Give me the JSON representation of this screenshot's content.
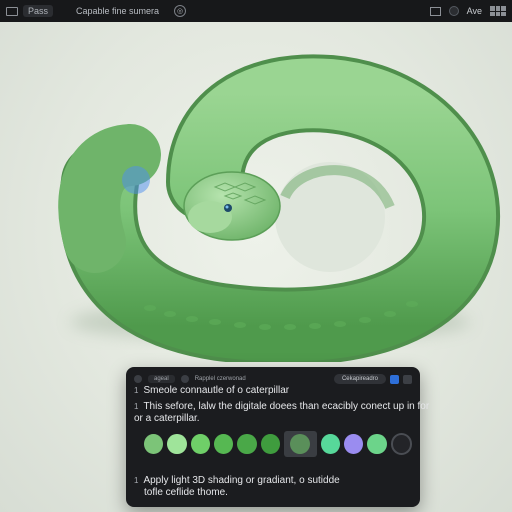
{
  "topbar": {
    "left_chip": "Pass",
    "title": "Capable fine sumera",
    "right_chip": "Ave"
  },
  "panel": {
    "toolbar_left": "ageal",
    "toolbar_middle": "Rapplel czerwonad",
    "toolbar_pill": "Cekapireadro",
    "line1_num": "1",
    "line1": "Smeole connautle of o caterpillar",
    "line2_num": "1",
    "line2a": "This sefore, lalw the digitale doees than ecacibly conect up in for",
    "line2b": "or a caterpillar.",
    "line3_num": "1",
    "line3a": "Apply light 3D shading or gradiant, o sutidde",
    "line3b": "tofle ceflide thome."
  },
  "swatches": [
    "#7cc478",
    "#9fe49a",
    "#6fcf68",
    "#56b852",
    "#4aa848",
    "#3f9c3e",
    "#5a8f5a",
    "#57d89a",
    "#9a8cf0",
    "#6cd48a"
  ],
  "colors": {
    "snake_body": "#7fc57a",
    "snake_shadow": "#4f9a4c",
    "panel_bg": "#1b1c1f"
  }
}
